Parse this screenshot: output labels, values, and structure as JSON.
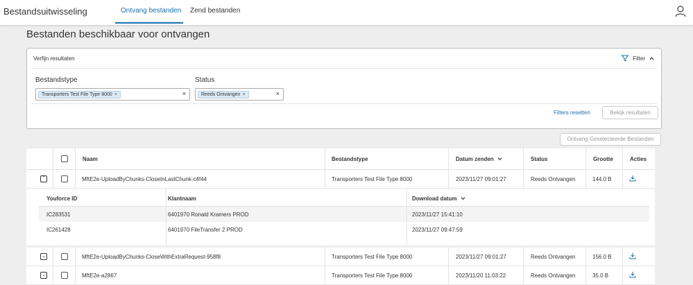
{
  "header": {
    "app_title": "Bestandsuitwisseling",
    "tabs": [
      {
        "label": "Ontvang bestanden",
        "active": true
      },
      {
        "label": "Zend bestanden",
        "active": false
      }
    ],
    "user_icon": "user-icon"
  },
  "page_title": "Bestanden beschikbaar voor ontvangen",
  "filter": {
    "heading": "Verfijn resultaten",
    "toggle_label": "Filter",
    "fields": [
      {
        "label": "Bestandstype",
        "chip": "Transporters Test File Type 8000"
      },
      {
        "label": "Status",
        "chip": "Reeds Ontvangen"
      }
    ],
    "reset_label": "Filters resetten",
    "view_label": "Bekijk resultaten"
  },
  "receive_selected_label": "Ontvang Geselecteerde Bestanden",
  "table": {
    "columns": [
      "Naam",
      "Bestandstype",
      "Datum zenden",
      "Status",
      "Grootte",
      "Acties"
    ],
    "rows": [
      {
        "name": "MftE2e-UploadByChunks-CloseInLastChunk-c4f44",
        "type": "Transporters Test File Type 8000",
        "date": "2023/11/27 09:01:27",
        "status": "Reeds Ontvangen",
        "size": "144.0 B",
        "expanded": true
      },
      {
        "name": "MftE2e-UploadByChunks-CloseWithExtraRequest-958f8",
        "type": "Transporters Test File Type 8000",
        "date": "2023/11/27 09:01:27",
        "status": "Reeds Ontvangen",
        "size": "156.0 B",
        "expanded": false
      },
      {
        "name": "MftE2e-a2867",
        "type": "Transporters Test File Type 8000",
        "date": "2023/11/20 11:03:22",
        "status": "Reeds Ontvangen",
        "size": "35.0 B",
        "expanded": false
      }
    ],
    "sub_table": {
      "columns": [
        "Youforce ID",
        "Klantnaam",
        "Download datum"
      ],
      "rows": [
        {
          "id": "IC283531",
          "client": "6401970 Ronald Kramers PROD",
          "date": "2023/11/27 15:41:10"
        },
        {
          "id": "IC261428",
          "client": "6401970 FileTransfer 2 PROD",
          "date": "2023/11/27 09:47:59"
        }
      ]
    }
  },
  "colors": {
    "accent": "#1a6fb0",
    "background": "#eeeeee"
  }
}
